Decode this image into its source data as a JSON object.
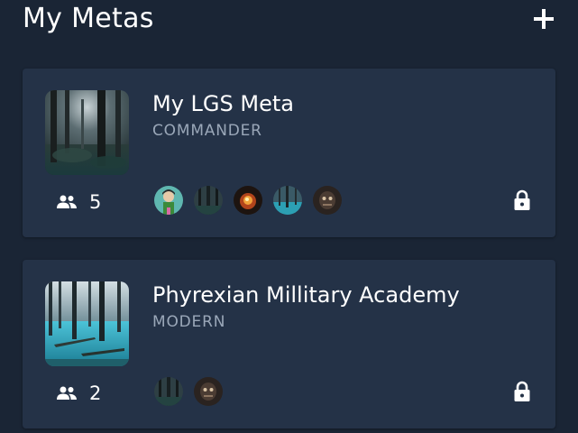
{
  "header": {
    "title": "My Metas",
    "add_icon": "plus-icon"
  },
  "metas": [
    {
      "name": "My LGS Meta",
      "format": "COMMANDER",
      "member_count": "5",
      "members_icon": "group-icon",
      "privacy_icon": "lock-icon",
      "avatars": [
        "avatar-green-character",
        "avatar-dark-forest",
        "avatar-fire",
        "avatar-blue-swamp",
        "avatar-dark-creature"
      ]
    },
    {
      "name": "Phyrexian Millitary Academy",
      "format": "MODERN",
      "member_count": "2",
      "members_icon": "group-icon",
      "privacy_icon": "lock-icon",
      "avatars": [
        "avatar-dark-forest",
        "avatar-dark-creature"
      ]
    }
  ],
  "colors": {
    "background": "#1a2535",
    "card": "#243247",
    "secondary_text": "#9aa7b8"
  }
}
